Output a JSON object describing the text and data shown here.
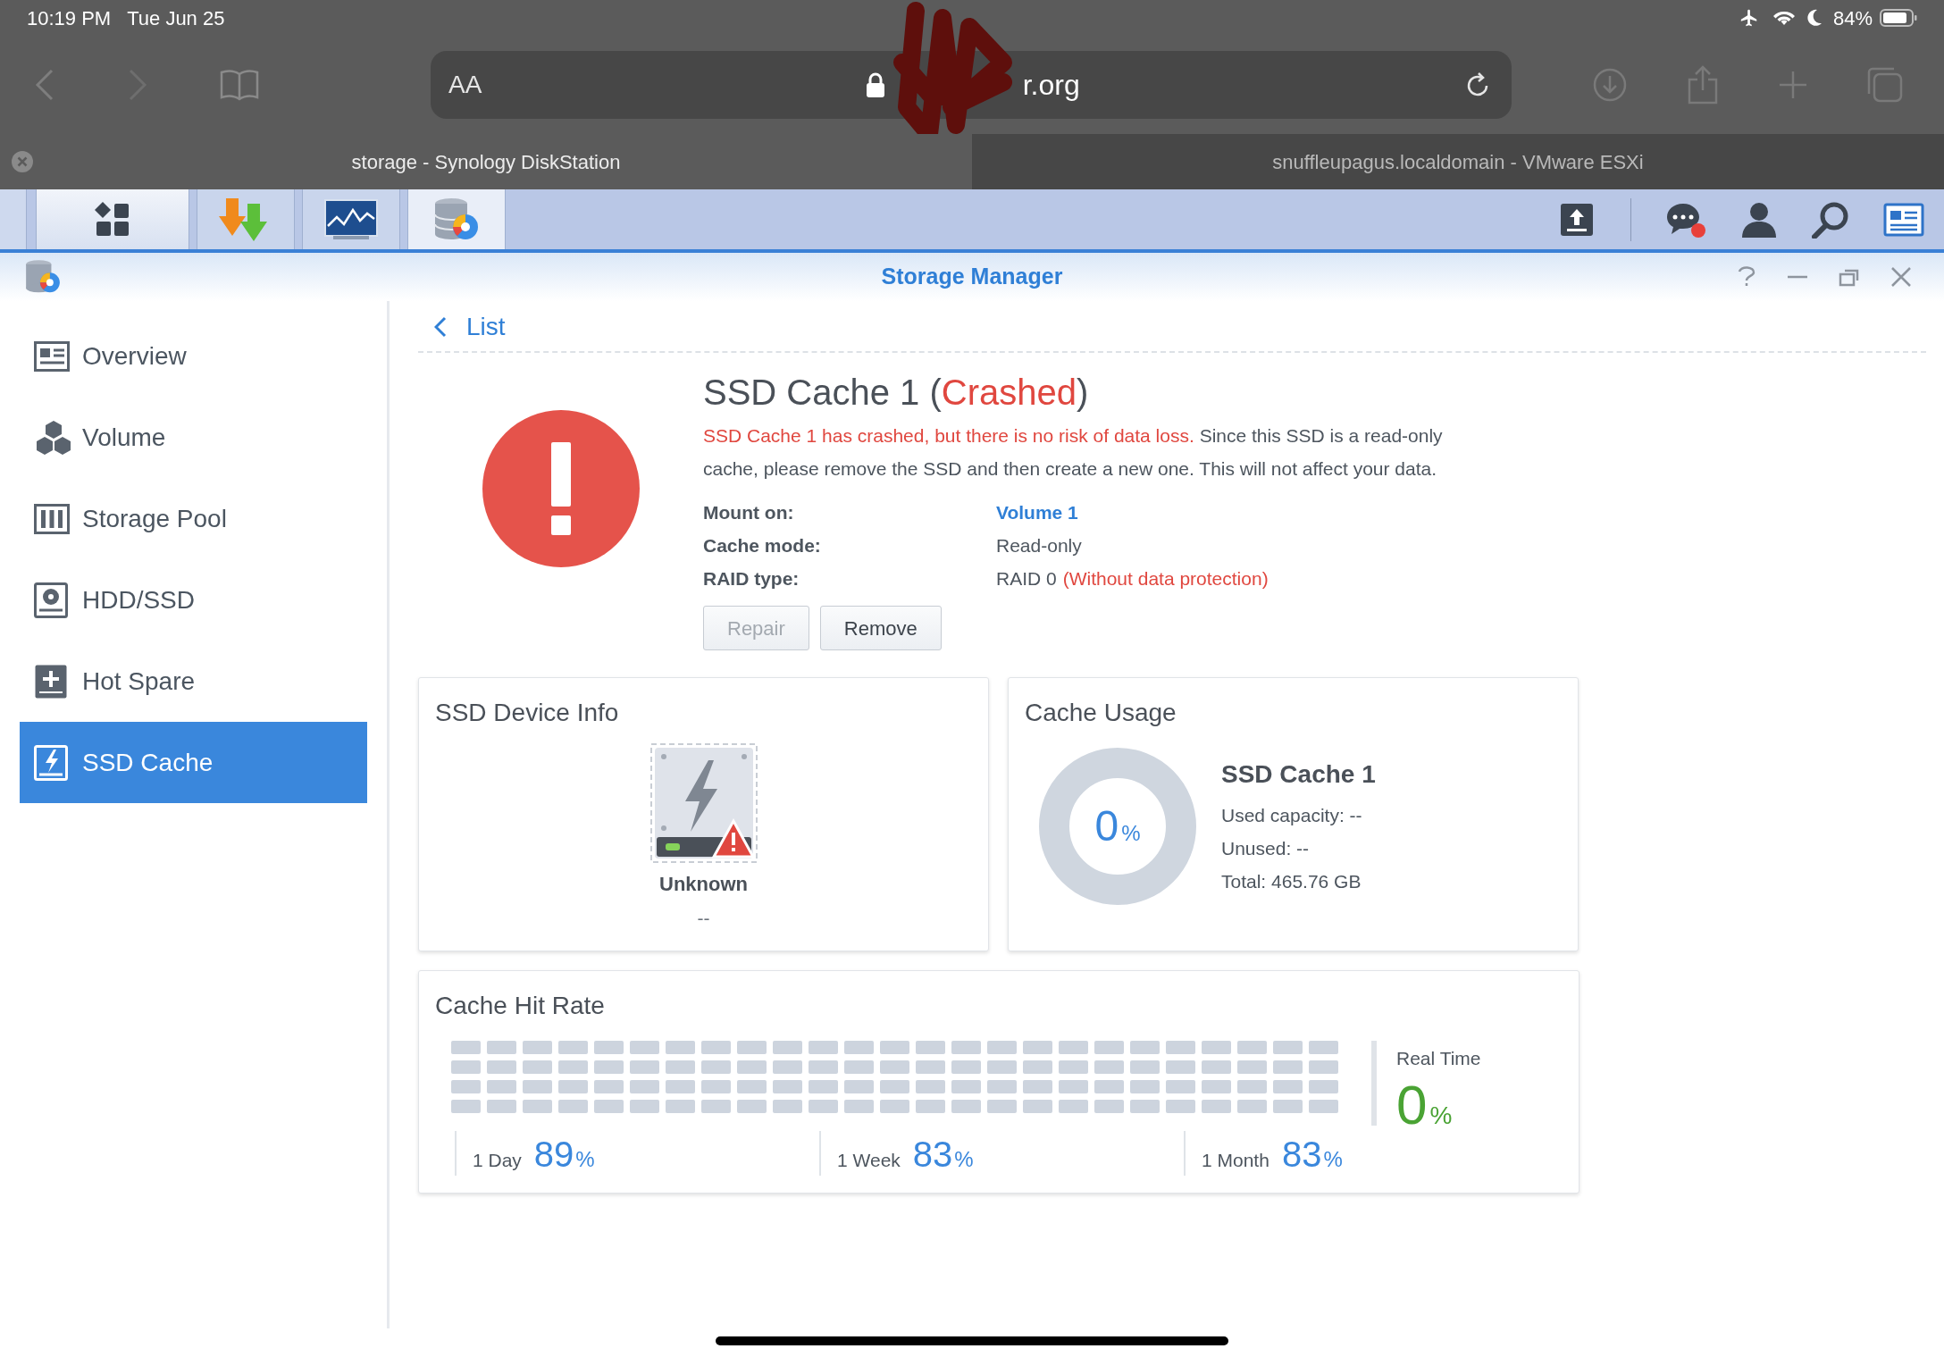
{
  "status_bar": {
    "time": "10:19 PM",
    "date": "Tue Jun 25",
    "battery": "84%"
  },
  "browser": {
    "text_size_button": "AA",
    "url": "r.org",
    "tabs": [
      {
        "title": "storage - Synology DiskStation",
        "selected": true
      },
      {
        "title": "snuffleupagus.localdomain - VMware ESXi",
        "selected": false
      }
    ]
  },
  "window": {
    "title": "Storage Manager"
  },
  "sidebar": {
    "items": [
      {
        "label": "Overview",
        "selected": false
      },
      {
        "label": "Volume",
        "selected": false
      },
      {
        "label": "Storage Pool",
        "selected": false
      },
      {
        "label": "HDD/SSD",
        "selected": false
      },
      {
        "label": "Hot Spare",
        "selected": false
      },
      {
        "label": "SSD Cache",
        "selected": true
      }
    ]
  },
  "back_link": "List",
  "detail": {
    "title": "SSD Cache 1 (",
    "status": "Crashed",
    "title_end": ")",
    "alert": "SSD Cache 1 has crashed, but there is no risk of data loss.",
    "message": "Since this SSD is a read-only cache, please remove the SSD and then create a new one. This will not affect your data.",
    "properties": [
      {
        "label": "Mount on:",
        "value": "Volume 1",
        "kind": "link"
      },
      {
        "label": "Cache mode:",
        "value": "Read-only",
        "kind": "plain"
      },
      {
        "label": "RAID type:",
        "value": "RAID 0",
        "note": "(Without data protection)",
        "kind": "plain"
      }
    ],
    "buttons": [
      {
        "label": "Repair",
        "disabled": true
      },
      {
        "label": "Remove",
        "disabled": false
      }
    ]
  },
  "device_info": {
    "title": "SSD Device Info",
    "name": "Unknown",
    "detail": "--"
  },
  "cache_usage": {
    "title": "Cache Usage",
    "percent": "0",
    "unit": "%",
    "name": "SSD Cache 1",
    "lines": [
      "Used capacity: --",
      "Unused: --",
      "Total: 465.76 GB"
    ]
  },
  "hit_rate": {
    "title": "Cache Hit Rate",
    "periods": [
      {
        "label": "1 Day",
        "value": "89",
        "unit": "%"
      },
      {
        "label": "1 Week",
        "value": "83",
        "unit": "%"
      },
      {
        "label": "1 Month",
        "value": "83",
        "unit": "%"
      }
    ],
    "realtime": {
      "label": "Real Time",
      "value": "0",
      "unit": "%"
    }
  }
}
